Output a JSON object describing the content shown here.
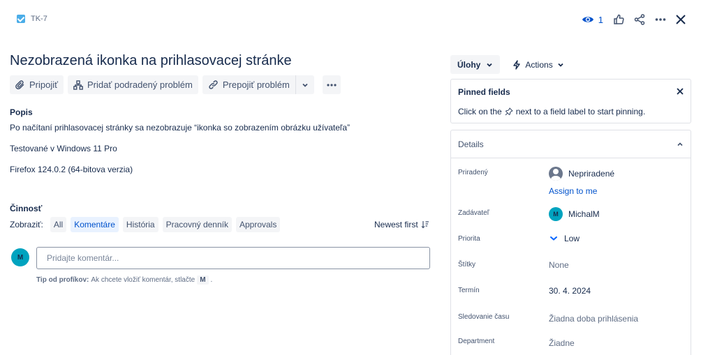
{
  "issue": {
    "key": "TK-7",
    "title": "Nezobrazená ikonka na prihlasovacej stránke",
    "watch_count": "1"
  },
  "toolbar": {
    "attach_label": "Pripojiť",
    "subtask_label": "Pridať podradený problém",
    "link_label": "Prepojiť problém"
  },
  "description": {
    "label": "Popis",
    "lines": [
      "Po načítaní prihlasovacej stránky sa nezobrazuje “ikonka so zobrazením obrázku užívateľa”",
      "Testované v Windows 11 Pro",
      "Firefox 124.0.2 (64-bitova verzia)"
    ]
  },
  "activity": {
    "label": "Činnosť",
    "show_label": "Zobraziť:",
    "filters": [
      "All",
      "Komentáre",
      "História",
      "Pracovný denník",
      "Approvals"
    ],
    "active_filter": "Komentáre",
    "sort_label": "Newest first",
    "comment_placeholder": "Pridajte komentár...",
    "current_user_initial": "M",
    "tip_bold": "Tip od profíkov:",
    "tip_text": "Ak chcete vložiť komentár, stlačte",
    "tip_key": "M",
    "tip_end": "."
  },
  "sidebar": {
    "status_label": "Úlohy",
    "actions_label": "Actions",
    "pinned": {
      "title": "Pinned fields",
      "text_before": "Click on the",
      "text_after": "next to a field label to start pinning."
    },
    "details_label": "Details",
    "fields": {
      "assignee_label": "Priradený",
      "assignee_value": "Nepriradené",
      "assign_to_me": "Assign to me",
      "reporter_label": "Zadávateľ",
      "reporter_value": "MichalM",
      "reporter_initial": "M",
      "priority_label": "Priorita",
      "priority_value": "Low",
      "labels_label": "Štítky",
      "labels_value": "None",
      "due_label": "Termín",
      "due_value": "30. 4. 2024",
      "time_label": "Sledovanie času",
      "time_value": "Žiadna doba prihlásenia",
      "department_label": "Department",
      "department_value": "Žiadne"
    }
  },
  "colors": {
    "accent": "#0052cc",
    "avatar": "#00a3bf",
    "issue_type": "#4bade8"
  }
}
